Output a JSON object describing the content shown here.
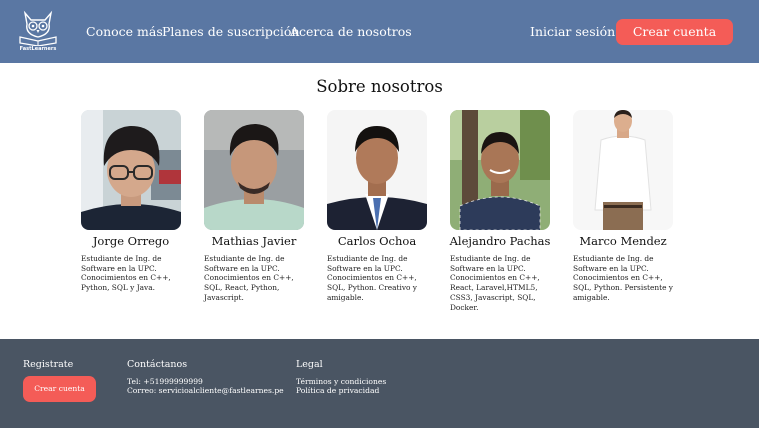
{
  "header": {
    "logo_text": "FastLearners",
    "nav": [
      "Conoce más",
      "Planes de suscripción",
      "Acerca de nosotros"
    ],
    "login_label": "Iniciar sesión",
    "signup_label": "Crear cuenta"
  },
  "main": {
    "title": "Sobre nosotros",
    "members": [
      {
        "name": "Jorge Orrego",
        "desc": "Estudiante de Ing. de Software en la UPC. Conocimientos en C++, Python, SQL y Java."
      },
      {
        "name": "Mathias Javier",
        "desc": "Estudiante de Ing. de Software en la UPC. Conocimientos en C++, SQL, React, Python, Javascript."
      },
      {
        "name": "Carlos Ochoa",
        "desc": "Estudiante de Ing. de Software en la UPC. Conocimientos en C++, SQL, Python. Creativo y amigable."
      },
      {
        "name": "Alejandro Pachas",
        "desc": "Estudiante de Ing. de Software en la UPC. Conocimientos en C++, React, Laravel,HTML5, CSS3, Javascript, SQL, Docker."
      },
      {
        "name": "Marco Mendez",
        "desc": "Estudiante de Ing. de Software en la UPC. Conocimientos en C++, SQL, Python. Persistente y amigable."
      }
    ]
  },
  "footer": {
    "register_heading": "Registrate",
    "register_button": "Crear cuenta",
    "contact_heading": "Contáctanos",
    "phone": "Tel: +51999999999",
    "email": "Correo: servicioalcliente@fastlearnes.pe",
    "legal_heading": "Legal",
    "terms": "Términos y condiciones",
    "privacy": "Política de privacidad"
  },
  "colors": {
    "navbar": "#5a77a3",
    "accent": "#f45c57",
    "footer": "#4a5563"
  }
}
